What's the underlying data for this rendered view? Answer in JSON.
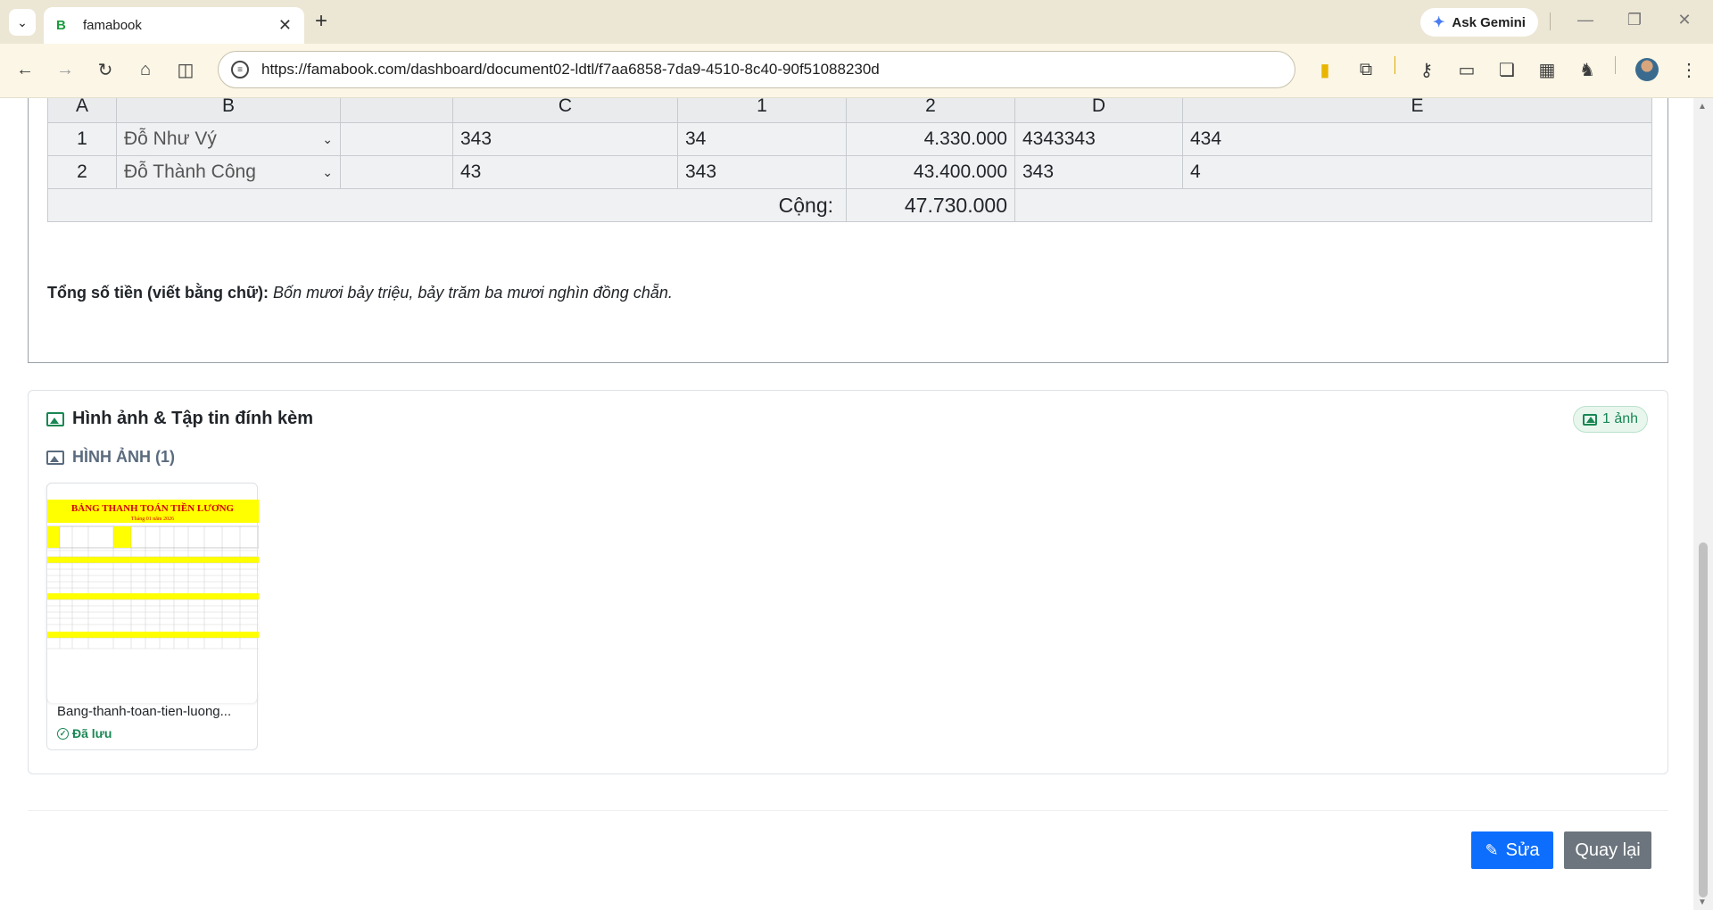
{
  "browser": {
    "tab_title": "famabook",
    "tab_favicon": "B",
    "ask_gemini": "Ask Gemini",
    "url": "https://famabook.com/dashboard/document02-ldtl/f7aa6858-7da9-4510-8c40-90f51088230d"
  },
  "table": {
    "headers": [
      "A",
      "B",
      "",
      "C",
      "1",
      "2",
      "D",
      "E"
    ],
    "rows": [
      {
        "a": "1",
        "b": "Đỗ Như Vý",
        "c": "343",
        "col1": "34",
        "col2": "4.330.000",
        "d": "4343343",
        "e": "434"
      },
      {
        "a": "2",
        "b": "Đỗ Thành Công",
        "c": "43",
        "col1": "343",
        "col2": "43.400.000",
        "d": "343",
        "e": "4"
      }
    ],
    "total_label": "Cộng:",
    "total_value": "47.730.000"
  },
  "words": {
    "label": "Tổng số tiền (viết bằng chữ):",
    "value": "Bốn mươi bảy triệu, bảy trăm ba mươi nghìn đồng chẵn."
  },
  "attachments": {
    "title": "Hình ảnh & Tập tin đính kèm",
    "count_badge": "1 ảnh",
    "images_title": "HÌNH ẢNH (1)",
    "file_name": "Bang-thanh-toan-tien-luong...",
    "status": "Đã lưu",
    "thumb_heading": "BẢNG THANH TOÁN TIỀN LƯƠNG",
    "thumb_subheading": "Tháng 01 năm 2026"
  },
  "actions": {
    "edit_label": "Sửa",
    "back_label": "Quay lại"
  },
  "colors": {
    "primary": "#0d6efd",
    "secondary": "#6c757d",
    "success": "#198754",
    "thumb_yellow": "#ffff00",
    "thumb_red": "#d40000"
  }
}
